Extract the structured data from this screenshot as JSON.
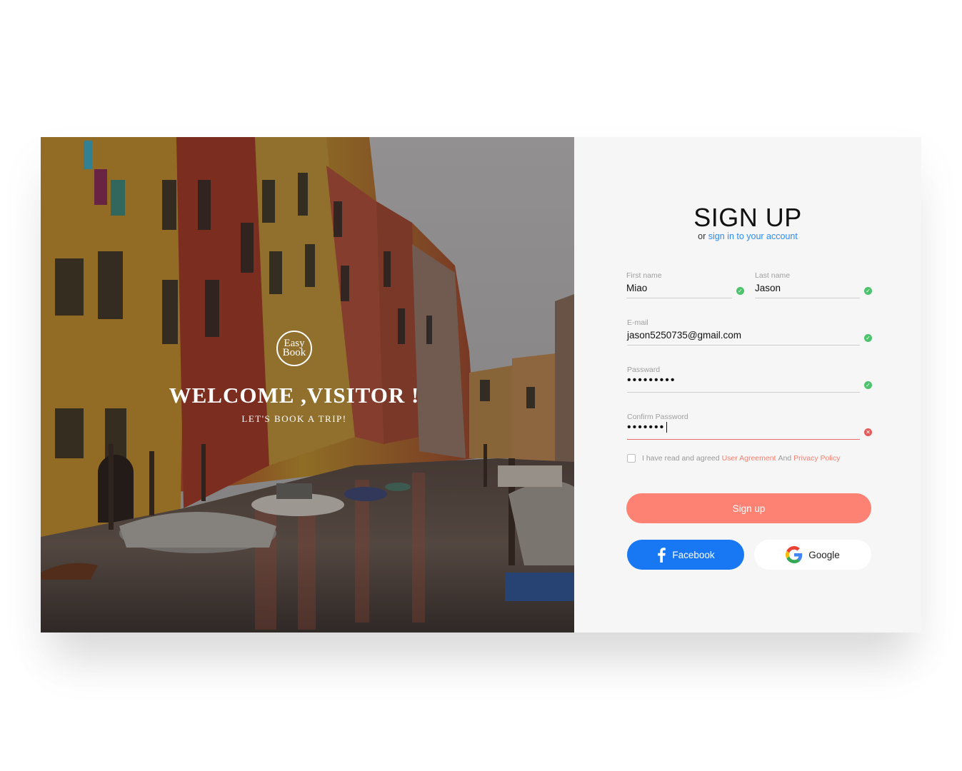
{
  "hero": {
    "logo_line1": "Easy",
    "logo_line2": "Book",
    "welcome": "WELCOME ,VISITOR !",
    "tagline": "LET'S BOOK A TRIP!"
  },
  "form": {
    "title": "SIGN UP",
    "subtitle_prefix": "or",
    "subtitle_link": "sign in to your account",
    "first_name": {
      "label": "First name",
      "value": "Miao",
      "status": "valid"
    },
    "last_name": {
      "label": "Last name",
      "value": "Jason",
      "status": "valid"
    },
    "email": {
      "label": "E-mail",
      "value": "jason5250735@gmail.com",
      "status": "valid"
    },
    "password": {
      "label": "Passward",
      "value": "•••••••••",
      "status": "valid"
    },
    "confirm_password": {
      "label": "Confirm Password",
      "value": "•••••••",
      "status": "invalid"
    },
    "agreement": {
      "text1": "I have read and agreed",
      "link1": "User Agreement",
      "text2": "And",
      "link2": "Privacy Policy",
      "checked": false
    },
    "signup_button": "Sign up",
    "facebook_button": "Facebook",
    "google_button": "Google"
  },
  "colors": {
    "accent": "#fd8273",
    "link": "#2f8cf0",
    "facebook": "#1877f2",
    "valid": "#4cc36c",
    "invalid": "#e85b5b",
    "panel_bg": "#f6f6f6"
  },
  "icons": {
    "valid": "check-circle-icon",
    "invalid": "x-circle-icon",
    "facebook": "facebook-icon",
    "google": "google-icon"
  }
}
